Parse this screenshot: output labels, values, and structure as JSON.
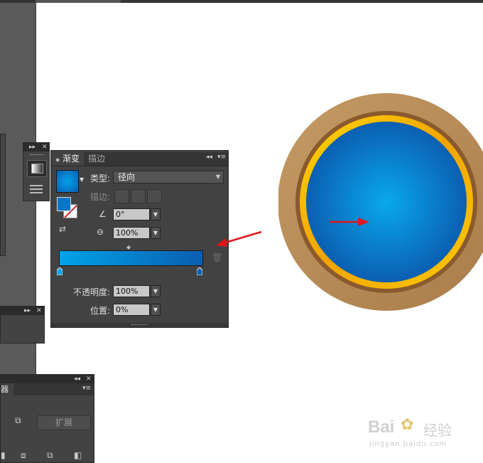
{
  "gradient_panel": {
    "tabs": [
      {
        "label": "渐变",
        "active": true
      },
      {
        "label": "描边",
        "active": false
      }
    ],
    "type_label": "类型:",
    "type_value": "径向",
    "stroke_label": "描边:",
    "angle_value": "0°",
    "ratio_value": "100%",
    "opacity_label": "不透明度:",
    "opacity_value": "100%",
    "position_label": "位置:",
    "position_value": "0%",
    "gradient_colors": [
      "#00a3e8",
      "#0a5eb0"
    ]
  },
  "bottom_panel": {
    "tab_fragment": "器",
    "expand_button": "扩展"
  },
  "watermark": {
    "brand_text": "Bai",
    "brand_text2": "经验",
    "url": "jingyan.baidu.com"
  },
  "colors": {
    "ring_outer": "#b58a57",
    "ring_gold": "#f2b400",
    "disc_center": "#0aa8ec",
    "disc_edge": "#0b5fb2",
    "arrow": "#e0161a",
    "panel_bg": "#424242"
  }
}
